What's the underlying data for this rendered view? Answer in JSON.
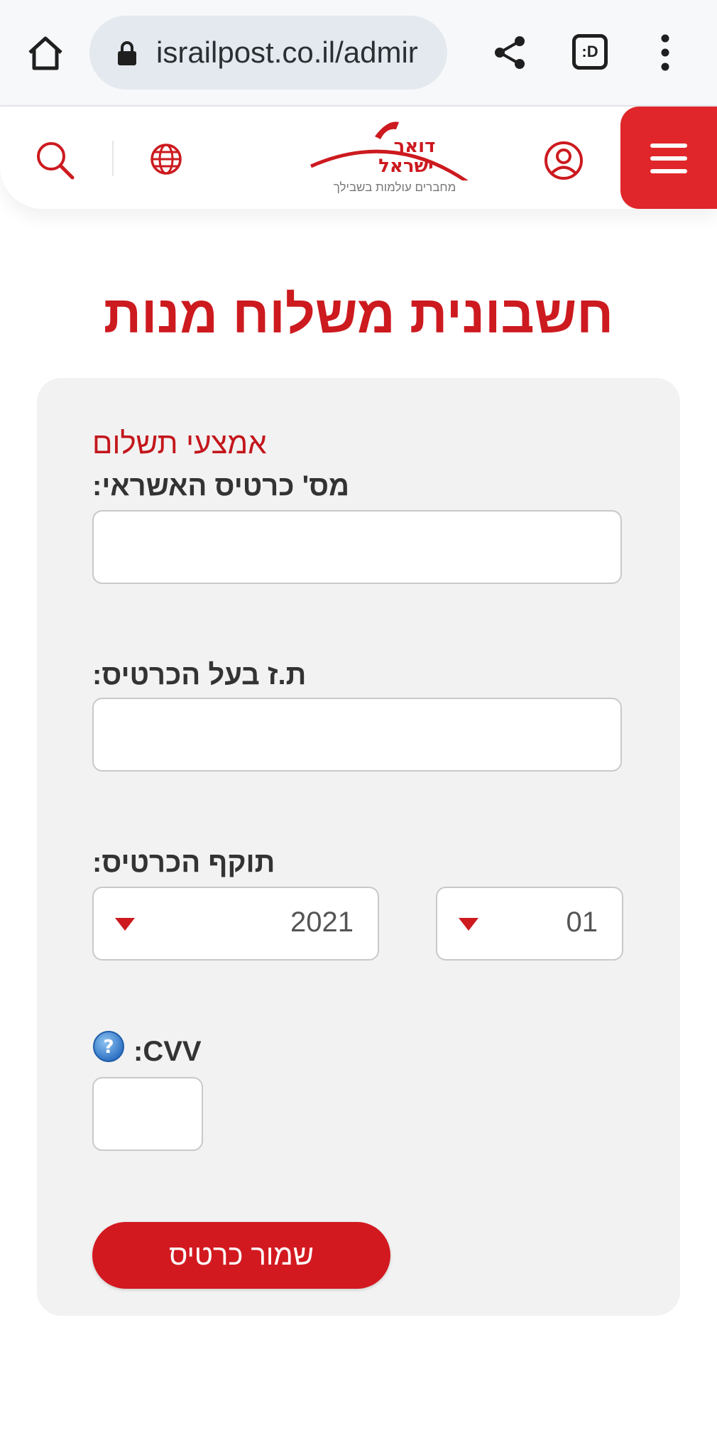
{
  "browser": {
    "url": "israilpost.co.il/admir",
    "tabs_label": ":D"
  },
  "header": {
    "logo_text_line1": "דואר",
    "logo_text_line2": "ישראל",
    "logo_tagline": "מחברים עולמות בשבילך"
  },
  "page": {
    "title": "חשבונית משלוח מנות"
  },
  "form": {
    "section_label": "אמצעי תשלום",
    "card_number_label": "מס' כרטיס האשראי:",
    "card_number_value": "",
    "id_label": "ת.ז בעל הכרטיס:",
    "id_value": "",
    "expiry_label": "תוקף הכרטיס:",
    "expiry_year": "2021",
    "expiry_month": "01",
    "cvv_label": ":CVV",
    "cvv_value": "",
    "save_label": "שמור כרטיס"
  },
  "colors": {
    "brand_red": "#cc1a1f",
    "button_red": "#d31920",
    "menu_red": "#e0262a",
    "card_bg": "#f2f2f2"
  },
  "icons": [
    "home-icon",
    "lock-icon",
    "share-icon",
    "tabs-icon",
    "more-vert-icon",
    "search-icon",
    "globe-icon",
    "user-icon",
    "hamburger-icon",
    "help-icon",
    "dropdown-arrow-icon"
  ]
}
